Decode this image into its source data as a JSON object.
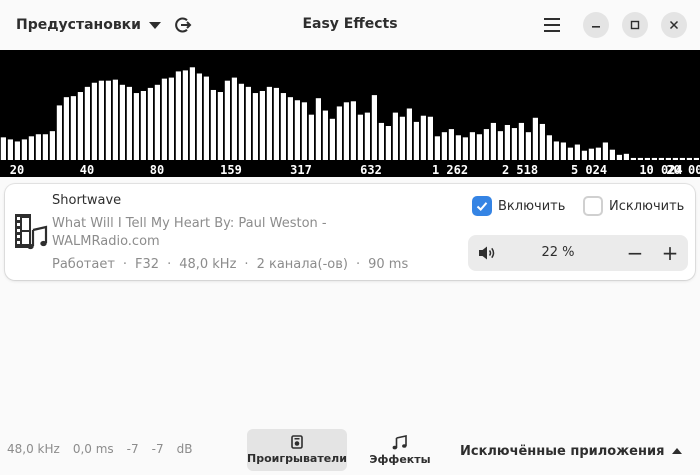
{
  "header": {
    "presets_label": "Предустановки",
    "title": "Easy Effects",
    "icons": [
      "caret-down-icon",
      "logout-icon",
      "menu-icon",
      "minimize-icon",
      "maximize-icon",
      "close-icon"
    ]
  },
  "spectrum": {
    "freq_labels": [
      "20",
      "40",
      "80",
      "159",
      "317",
      "632",
      "1 262",
      "2 518",
      "5 024",
      "10 024",
      "20 000"
    ],
    "levels": [
      0.22,
      0.2,
      0.18,
      0.2,
      0.23,
      0.25,
      0.25,
      0.28,
      0.53,
      0.61,
      0.62,
      0.66,
      0.71,
      0.75,
      0.77,
      0.77,
      0.78,
      0.73,
      0.71,
      0.65,
      0.67,
      0.7,
      0.73,
      0.79,
      0.8,
      0.86,
      0.87,
      0.9,
      0.84,
      0.81,
      0.68,
      0.66,
      0.77,
      0.8,
      0.74,
      0.71,
      0.65,
      0.67,
      0.71,
      0.7,
      0.65,
      0.61,
      0.58,
      0.56,
      0.44,
      0.6,
      0.48,
      0.4,
      0.52,
      0.56,
      0.57,
      0.44,
      0.46,
      0.63,
      0.36,
      0.33,
      0.46,
      0.42,
      0.5,
      0.37,
      0.43,
      0.42,
      0.23,
      0.27,
      0.3,
      0.24,
      0.22,
      0.27,
      0.25,
      0.3,
      0.36,
      0.28,
      0.34,
      0.31,
      0.36,
      0.27,
      0.41,
      0.35,
      0.24,
      0.18,
      0.17,
      0.12,
      0.15,
      0.09,
      0.11,
      0.12,
      0.17,
      0.1,
      0.05,
      0.06,
      0.02,
      0.02,
      0.02,
      0.02,
      0.02,
      0.02,
      0.02,
      0.02,
      0.02,
      0.02
    ]
  },
  "player": {
    "app_name": "Shortwave",
    "media_title": "What Will I Tell My Heart  By: Paul Weston - WALMRadio.com",
    "status": "Работает",
    "format": "F32",
    "rate": "48,0 kHz",
    "channels": "2 канала(-ов)",
    "latency": "90 ms",
    "enable_label": "Включить",
    "enable_checked": true,
    "exclude_label": "Исключить",
    "exclude_checked": false,
    "volume_text": "22 %",
    "volume_level": 0.22,
    "minus": "−",
    "plus": "+",
    "accent": "#3584e4"
  },
  "bottom": {
    "rate": "48,0 kHz",
    "latency": "0,0 ms",
    "level_left": "-7",
    "level_right": "-7",
    "unit": "dB",
    "players_label": "Проигрыватели",
    "effects_label": "Эффекты",
    "excluded_label": "Исключённые приложения"
  }
}
